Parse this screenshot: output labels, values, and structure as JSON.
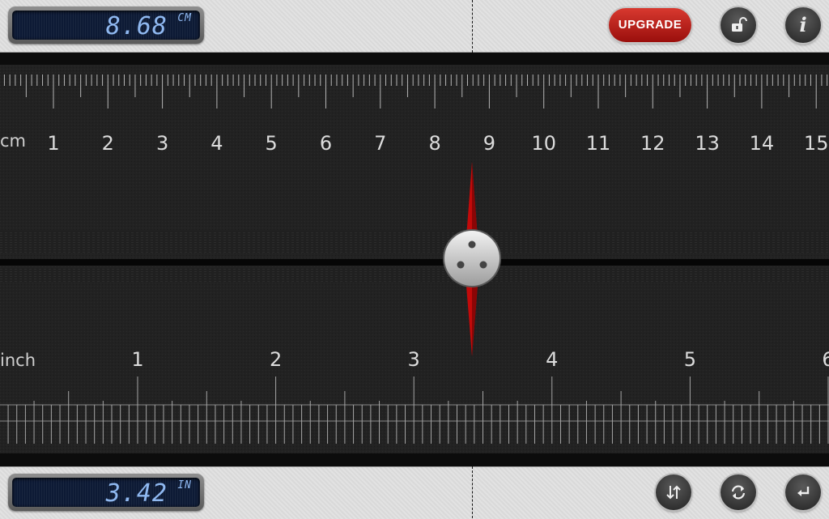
{
  "top_display": {
    "value": "8.68",
    "unit": "CM"
  },
  "bottom_display": {
    "value": "3.42",
    "unit": "IN"
  },
  "toolbar": {
    "upgrade_label": "UPGRADE",
    "info_label": "i"
  },
  "icons": {
    "lock": "unlocked-padlock-icon",
    "info": "info-icon",
    "swap": "swap-direction-icon",
    "rotate": "rotate-icon",
    "return": "return-icon"
  },
  "ruler_cm": {
    "unit_label": "cm",
    "labels": [
      "1",
      "2",
      "3",
      "4",
      "5",
      "6",
      "7",
      "8",
      "9",
      "10",
      "11",
      "12",
      "13",
      "14",
      "15"
    ],
    "measured_cm": 8.68
  },
  "ruler_inch": {
    "unit_label": "inch",
    "labels": [
      "1",
      "2",
      "3",
      "4",
      "5",
      "6"
    ],
    "measured_in": 3.42
  },
  "colors": {
    "lcd_text": "#8fb8f0",
    "upgrade_red": "#c0241d",
    "ruler_bg": "#1e1e1e",
    "tick": "#bdbdbd",
    "needle_red": "#c20a0a"
  }
}
